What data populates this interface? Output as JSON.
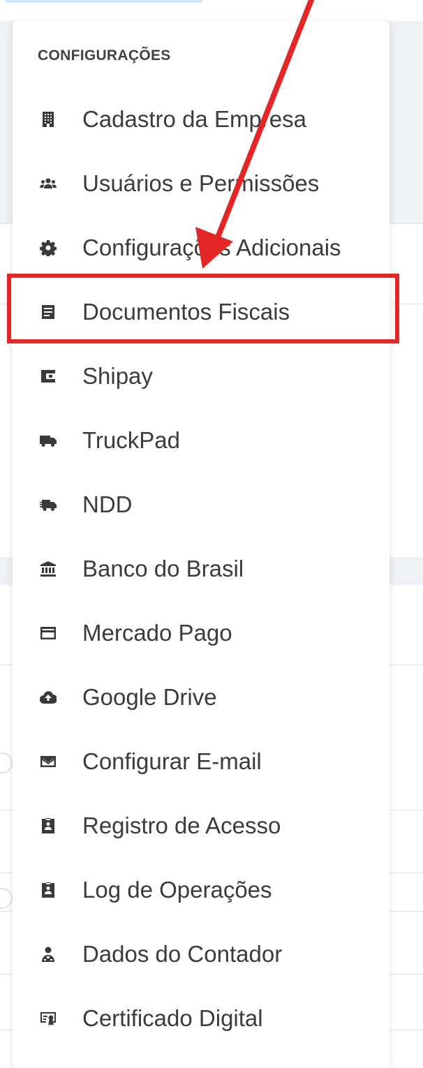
{
  "menu": {
    "header": "CONFIGURAÇÕES",
    "items": [
      {
        "label": "Cadastro da Empresa",
        "icon": "building-icon"
      },
      {
        "label": "Usuários e Permissões",
        "icon": "users-icon"
      },
      {
        "label": "Configurações Adicionais",
        "icon": "gear-icon"
      },
      {
        "label": "Documentos Fiscais",
        "icon": "document-icon"
      },
      {
        "label": "Shipay",
        "icon": "wallet-icon"
      },
      {
        "label": "TruckPad",
        "icon": "truck-icon"
      },
      {
        "label": "NDD",
        "icon": "fast-truck-icon"
      },
      {
        "label": "Banco do Brasil",
        "icon": "bank-icon"
      },
      {
        "label": "Mercado Pago",
        "icon": "credit-card-icon"
      },
      {
        "label": "Google Drive",
        "icon": "cloud-upload-icon"
      },
      {
        "label": "Configurar E-mail",
        "icon": "envelope-icon"
      },
      {
        "label": "Registro de Acesso",
        "icon": "id-badge-icon"
      },
      {
        "label": "Log de Operações",
        "icon": "id-badge-icon"
      },
      {
        "label": "Dados do Contador",
        "icon": "accountant-icon"
      },
      {
        "label": "Certificado Digital",
        "icon": "certificate-icon"
      }
    ]
  },
  "annotation": {
    "highlighted_item": "Documentos Fiscais",
    "color": "#e32626"
  }
}
